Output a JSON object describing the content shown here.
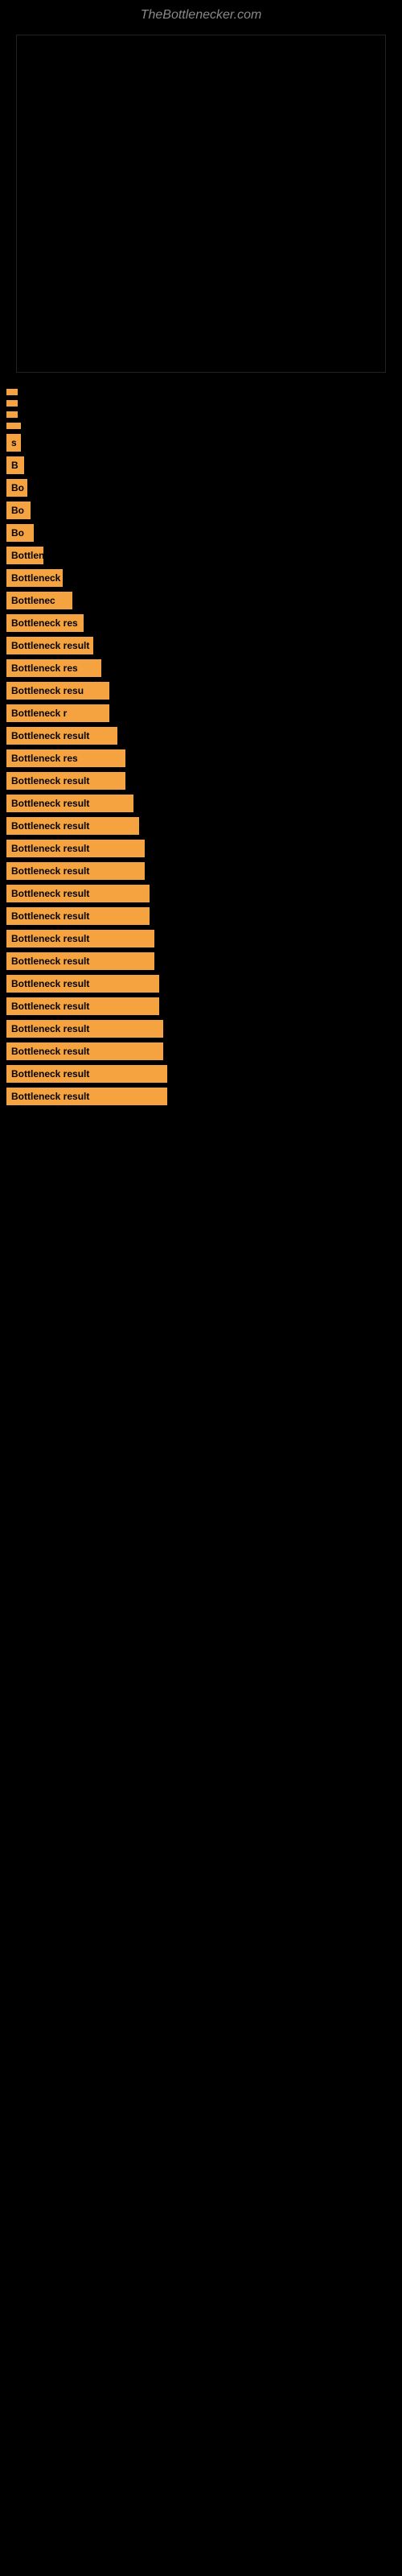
{
  "site": {
    "title": "TheBottlenecker.com"
  },
  "results": [
    {
      "id": 1,
      "label": "",
      "barClass": "bar-w-1"
    },
    {
      "id": 2,
      "label": "",
      "barClass": "bar-w-1"
    },
    {
      "id": 3,
      "label": "",
      "barClass": "bar-w-1"
    },
    {
      "id": 4,
      "label": "",
      "barClass": "bar-w-2"
    },
    {
      "id": 5,
      "label": "s",
      "barClass": "bar-w-2"
    },
    {
      "id": 6,
      "label": "B",
      "barClass": "bar-w-3"
    },
    {
      "id": 7,
      "label": "Bo",
      "barClass": "bar-w-4"
    },
    {
      "id": 8,
      "label": "Bo",
      "barClass": "bar-w-5"
    },
    {
      "id": 9,
      "label": "Bo",
      "barClass": "bar-w-6"
    },
    {
      "id": 10,
      "label": "Bottlene",
      "barClass": "bar-w-8"
    },
    {
      "id": 11,
      "label": "Bottleneck re",
      "barClass": "bar-w-10"
    },
    {
      "id": 12,
      "label": "Bottlenec",
      "barClass": "bar-w-11"
    },
    {
      "id": 13,
      "label": "Bottleneck res",
      "barClass": "bar-w-12"
    },
    {
      "id": 14,
      "label": "Bottleneck result",
      "barClass": "bar-w-13"
    },
    {
      "id": 15,
      "label": "Bottleneck res",
      "barClass": "bar-w-14"
    },
    {
      "id": 16,
      "label": "Bottleneck resu",
      "barClass": "bar-w-15"
    },
    {
      "id": 17,
      "label": "Bottleneck r",
      "barClass": "bar-w-15"
    },
    {
      "id": 18,
      "label": "Bottleneck result",
      "barClass": "bar-w-16"
    },
    {
      "id": 19,
      "label": "Bottleneck res",
      "barClass": "bar-w-17"
    },
    {
      "id": 20,
      "label": "Bottleneck result",
      "barClass": "bar-w-17"
    },
    {
      "id": 21,
      "label": "Bottleneck result",
      "barClass": "bar-w-18"
    },
    {
      "id": 22,
      "label": "Bottleneck result",
      "barClass": "bar-w-19"
    },
    {
      "id": 23,
      "label": "Bottleneck result",
      "barClass": "bar-w-20"
    },
    {
      "id": 24,
      "label": "Bottleneck result",
      "barClass": "bar-w-20"
    },
    {
      "id": 25,
      "label": "Bottleneck result",
      "barClass": "bar-w-21"
    },
    {
      "id": 26,
      "label": "Bottleneck result",
      "barClass": "bar-w-21"
    },
    {
      "id": 27,
      "label": "Bottleneck result",
      "barClass": "bar-w-22"
    },
    {
      "id": 28,
      "label": "Bottleneck result",
      "barClass": "bar-w-22"
    },
    {
      "id": 29,
      "label": "Bottleneck result",
      "barClass": "bar-w-23"
    },
    {
      "id": 30,
      "label": "Bottleneck result",
      "barClass": "bar-w-23"
    },
    {
      "id": 31,
      "label": "Bottleneck result",
      "barClass": "bar-w-24"
    },
    {
      "id": 32,
      "label": "Bottleneck result",
      "barClass": "bar-w-24"
    },
    {
      "id": 33,
      "label": "Bottleneck result",
      "barClass": "bar-w-25"
    },
    {
      "id": 34,
      "label": "Bottleneck result",
      "barClass": "bar-w-25"
    }
  ]
}
